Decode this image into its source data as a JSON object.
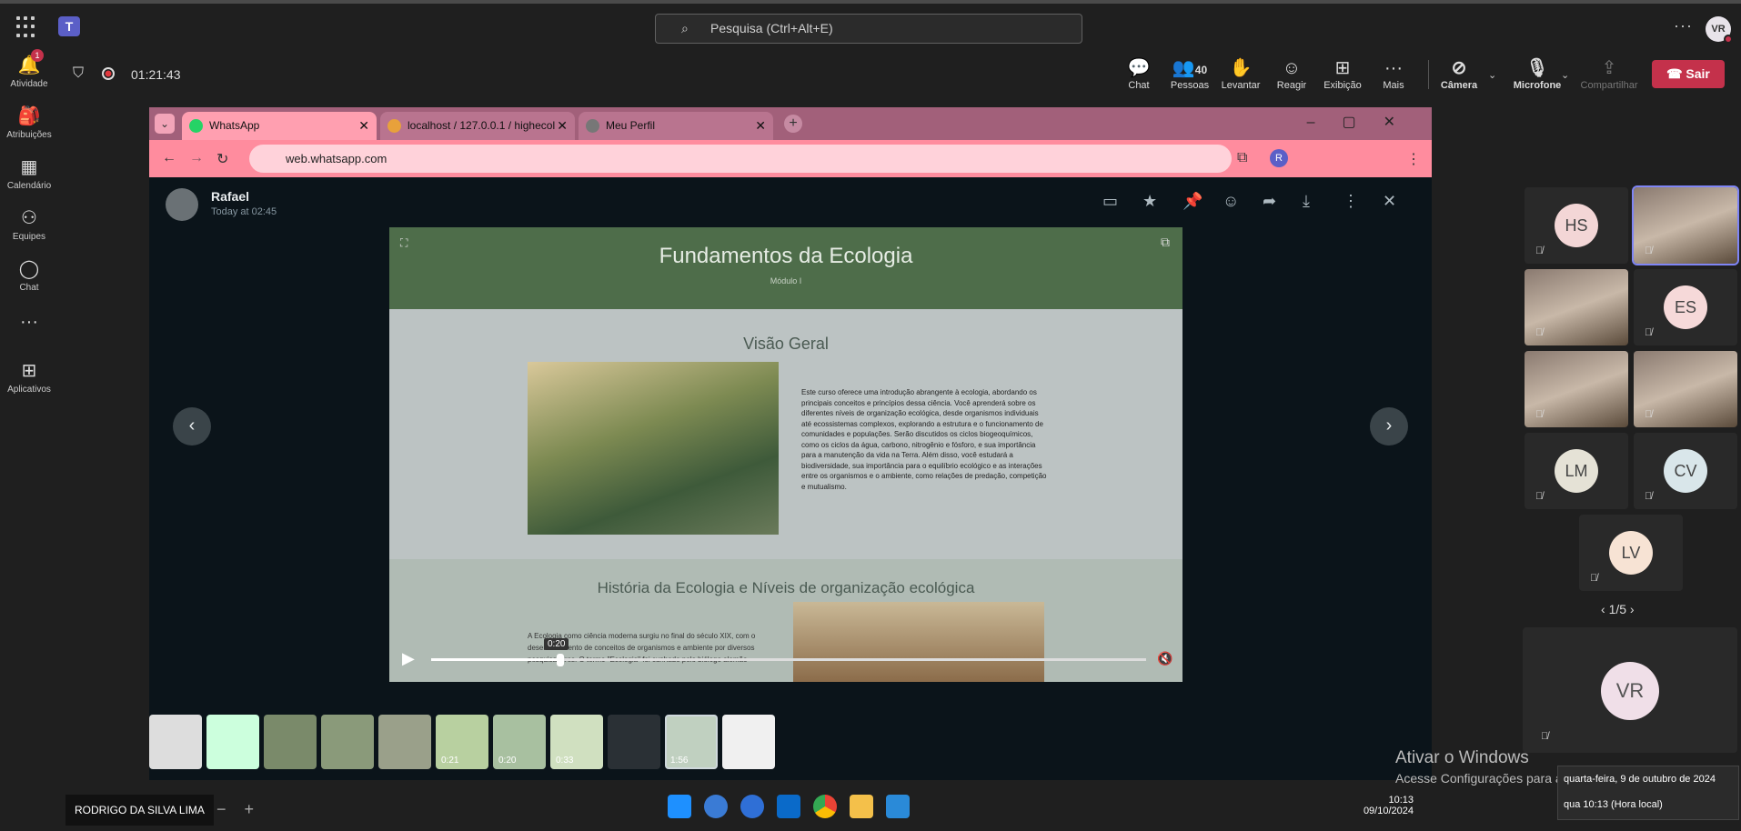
{
  "topbar": {
    "search_placeholder": "Pesquisa (Ctrl+Alt+E)",
    "avatar_initials": "VR"
  },
  "rail": [
    {
      "label": "Atividade",
      "icon": "bell-icon",
      "badge": "1"
    },
    {
      "label": "Atribuições",
      "icon": "backpack-icon"
    },
    {
      "label": "Calendário",
      "icon": "calendar-icon"
    },
    {
      "label": "Equipes",
      "icon": "people-icon"
    },
    {
      "label": "Chat",
      "icon": "chat-icon"
    },
    {
      "label": "",
      "icon": "more-icon"
    },
    {
      "label": "Aplicativos",
      "icon": "plus-icon"
    }
  ],
  "meeting": {
    "timer": "01:21:43",
    "buttons": {
      "chat": "Chat",
      "people": "Pessoas",
      "people_count": "40",
      "raise": "Levantar",
      "react": "Reagir",
      "view": "Exibição",
      "more": "Mais",
      "camera": "Câmera",
      "mic": "Microfone",
      "share": "Compartilhar",
      "leave": "Sair"
    }
  },
  "browser": {
    "tabs": [
      {
        "title": "WhatsApp"
      },
      {
        "title": "localhost / 127.0.0.1 / highecol"
      },
      {
        "title": "Meu Perfil"
      }
    ],
    "url": "web.whatsapp.com"
  },
  "viewer": {
    "sender": "Rafael",
    "time": "Today at 02:45",
    "video": {
      "title": "Fundamentos da Ecologia",
      "subtitle": "Módulo I",
      "section1": "Visão Geral",
      "text": "Este curso oferece uma introdução abrangente à ecologia, abordando os principais conceitos e princípios dessa ciência. Você aprenderá sobre os diferentes níveis de organização ecológica, desde organismos individuais até ecossistemas complexos, explorando a estrutura e o funcionamento de comunidades e populações. Serão discutidos os ciclos biogeoquímicos, como os ciclos da água, carbono, nitrogênio e fósforo, e sua importância para a manutenção da vida na Terra. Além disso, você estudará a biodiversidade, sua importância para o equilíbrio ecológico e as interações entre os organismos e o ambiente, como relações de predação, competição e mutualismo.",
      "section2": "História da Ecologia e Níveis de organização ecológica",
      "section2_text": "A Ecologia como ciência moderna surgiu no final do século XIX, com o desenvolvimento de conceitos de organismos e ambiente por diversos pesquisadores. O termo \"Ecologia\" foi cunhado pelo biólogo alemão",
      "seek_time": "0:20",
      "progress": 0.18
    },
    "thumbs": [
      {
        "dur": ""
      },
      {
        "dur": ""
      },
      {
        "dur": ""
      },
      {
        "dur": ""
      },
      {
        "dur": ""
      },
      {
        "dur": "0:21"
      },
      {
        "dur": "0:20"
      },
      {
        "dur": "0:33"
      },
      {
        "dur": ""
      },
      {
        "dur": "1:56"
      },
      {
        "dur": ""
      }
    ]
  },
  "participants": [
    {
      "initials": "HS",
      "color": "#f3d6d6"
    },
    {
      "initials": "",
      "video": true
    },
    {
      "initials": "",
      "video": true
    },
    {
      "initials": "ES",
      "color": "#f6d9d9"
    },
    {
      "initials": "",
      "video": true
    },
    {
      "initials": "",
      "video": true
    },
    {
      "initials": "LM",
      "color": "#e5e2d6"
    },
    {
      "initials": "CV",
      "color": "#d9e6ea"
    },
    {
      "initials": "LV",
      "color": "#f7e3d4"
    }
  ],
  "pager": "1/5",
  "self": {
    "initials": "VR"
  },
  "bottom": {
    "name": "RODRIGO DA SILVA LIMA",
    "activate_title": "Ativar o Windows",
    "activate_sub": "Acesse Configurações para ativar o Windows.",
    "clock_time": "10:13",
    "clock_date": "09/10/2024",
    "tooltip_line1": "quarta-feira, 9 de outubro de 2024",
    "tooltip_line2": "qua 10:13 (Hora local)"
  }
}
